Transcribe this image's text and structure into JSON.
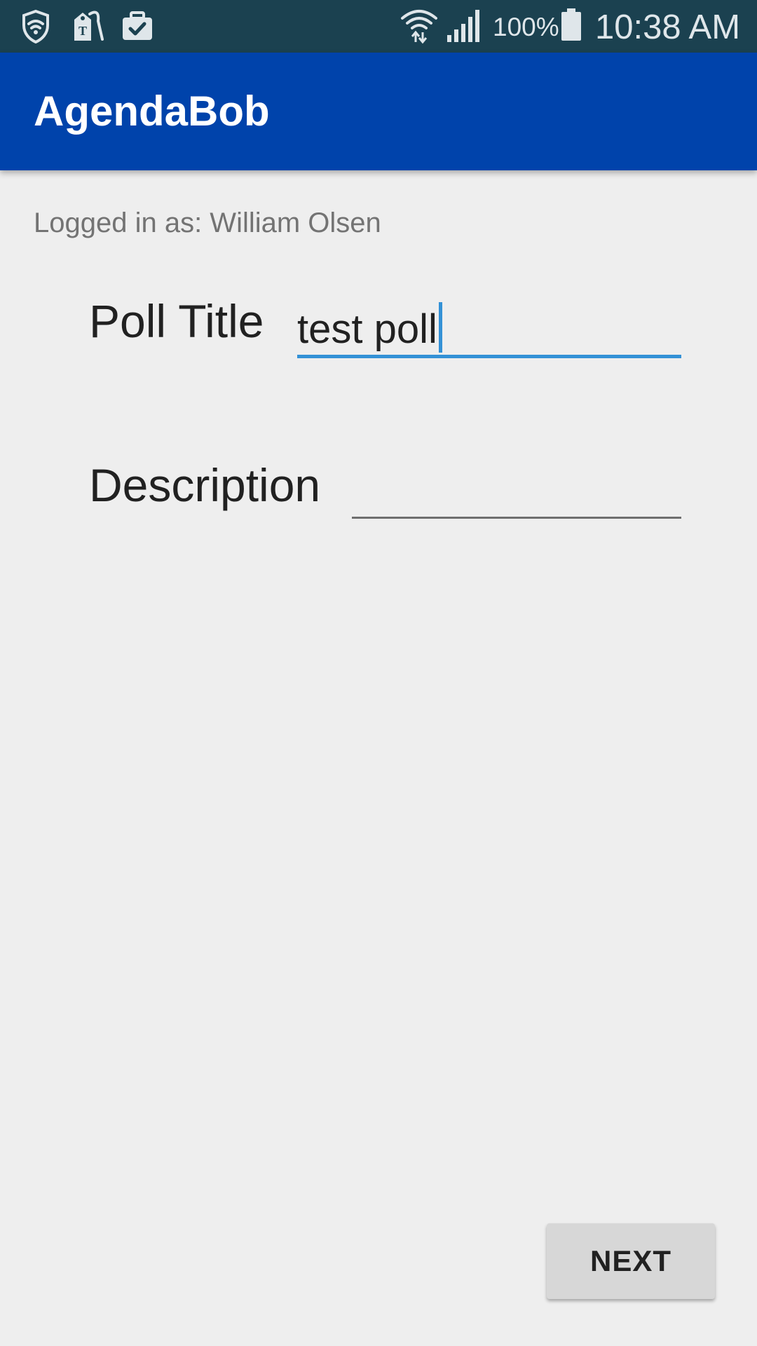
{
  "status_bar": {
    "left_icons": [
      "wifi-shield-icon",
      "tmobile-tag-icon",
      "briefcase-check-icon"
    ],
    "right_icons": [
      "wifi-icon",
      "signal-icon",
      "battery-icon"
    ],
    "battery_percent": "100%",
    "time": "10:38 AM",
    "background": "#1b4150"
  },
  "app_bar": {
    "title": "AgendaBob",
    "background": "#0043ab"
  },
  "content": {
    "logged_in_text": "Logged in as: William Olsen",
    "poll_title": {
      "label": "Poll Title",
      "value": "test poll",
      "focused": true
    },
    "description": {
      "label": "Description",
      "value": ""
    },
    "accent_color": "#3391d6"
  },
  "actions": {
    "next_label": "NEXT"
  }
}
